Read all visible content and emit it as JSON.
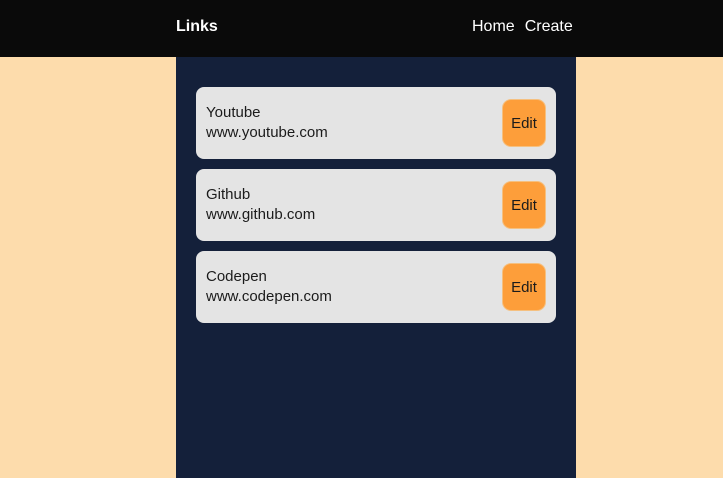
{
  "nav": {
    "brand": "Links",
    "links": [
      "Home",
      "Create"
    ]
  },
  "links": [
    {
      "title": "Youtube",
      "url": "www.youtube.com",
      "action": "Edit"
    },
    {
      "title": "Github",
      "url": "www.github.com",
      "action": "Edit"
    },
    {
      "title": "Codepen",
      "url": "www.codepen.com",
      "action": "Edit"
    }
  ],
  "colors": {
    "page_background": "#fddcac",
    "navbar_background": "#0a0a0a",
    "panel_background": "#14203a",
    "card_background": "#e4e4e4",
    "button_background": "#fd9e3a"
  }
}
